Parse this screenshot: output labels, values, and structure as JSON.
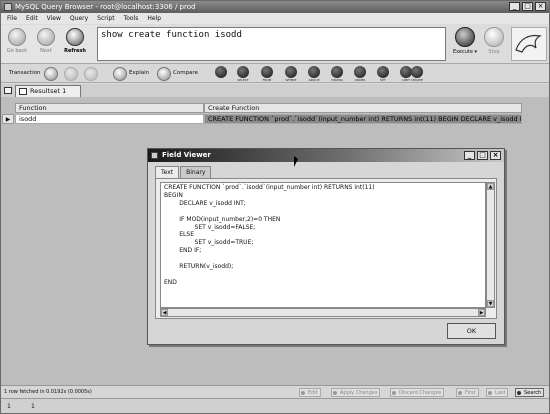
{
  "window": {
    "title": "MySQL Query Browser - root@localhost:3306 / prod"
  },
  "menu": [
    "File",
    "Edit",
    "View",
    "Query",
    "Script",
    "Tools",
    "Help"
  ],
  "nav": {
    "back": "Go back",
    "next": "Next",
    "refresh": "Refresh"
  },
  "query": {
    "text": "show create function isodd"
  },
  "exec": {
    "execute": "Execute ▾",
    "stop": "Stop"
  },
  "toolbar2": {
    "transaction": "Transaction",
    "explain": "Explain",
    "compare": "Compare"
  },
  "sql_buttons": [
    "SELECT",
    "FROM",
    "WHERE",
    "GROUP",
    "HAVING",
    "ORDER",
    "SET",
    "LIMIT",
    "UPDATE"
  ],
  "resultset": {
    "tab_label": "Resultset 1",
    "columns": [
      "Function",
      "Create Function"
    ],
    "rows": [
      [
        "isodd",
        "CREATE FUNCTION `prod`.`isodd`(input_number int) RETURNS int(11) BEGIN DECLARE v_isodd INT; ..."
      ]
    ]
  },
  "status": {
    "fetched": "1 row fetched in 0.0192s (0.0005s)",
    "edit": "Edit",
    "apply": "Apply Changes",
    "discard": "Discard Changes",
    "first": "First",
    "last": "Last",
    "search": "Search"
  },
  "position": {
    "col": "1",
    "row": "1"
  },
  "dialog": {
    "title": "Field Viewer",
    "tabs": [
      "Text",
      "Binary"
    ],
    "content": "CREATE FUNCTION `prod`.`isodd`(input_number int) RETURNS int(11)\nBEGIN\n        DECLARE v_isodd INT;\n\n        IF MOD(input_number,2)=0 THEN\n                SET v_isodd=FALSE;\n        ELSE\n                SET v_isodd=TRUE;\n        END IF;\n\n        RETURN(v_isodd);\n\nEND",
    "ok": "OK"
  }
}
